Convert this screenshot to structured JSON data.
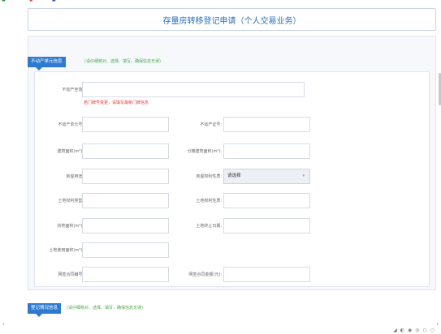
{
  "title": "存量房转移登记申请（个人交易业务）",
  "section1": {
    "tab": "不动产单元信息",
    "note": "(请仔细核对、选择、填写，确保信息无误)"
  },
  "section2": {
    "tab": "登记情况信息",
    "note": "(请仔细核对、选择、填写，确保信息无误)"
  },
  "fields": {
    "location_label": "不动产坐落:",
    "location_warning": "若门牌号变更，请填写最新门牌信息",
    "unit_no_label": "不动产单元号:",
    "cert_no_label": "不动产证号:",
    "building_area_label": "建筑面积(m²):",
    "shared_area_label": "分摊建筑面积(m²):",
    "house_use_label": "房屋用途:",
    "house_right_label": "房屋权利性质:",
    "house_right_value": "请选择",
    "land_use_label": "土地权利类型:",
    "land_right_label": "土地权利性质:",
    "parcel_area_label": "宗地面积(m²):",
    "land_end_label": "土地终止日期:",
    "land_use_area_label": "土地使用面积(m²):",
    "contract_no_label": "网签合同编号:",
    "contract_amount_label": "网签合同金额(元):"
  },
  "icons": {
    "dropdown": "chevron-down-icon",
    "scroll_left": "arrow-left-icon",
    "scroll_right": "arrow-right-icon"
  },
  "colors": {
    "accent": "#2e7ad1",
    "title": "#2b6fb8",
    "note": "#4aa84a",
    "warning": "#e23a3a"
  }
}
